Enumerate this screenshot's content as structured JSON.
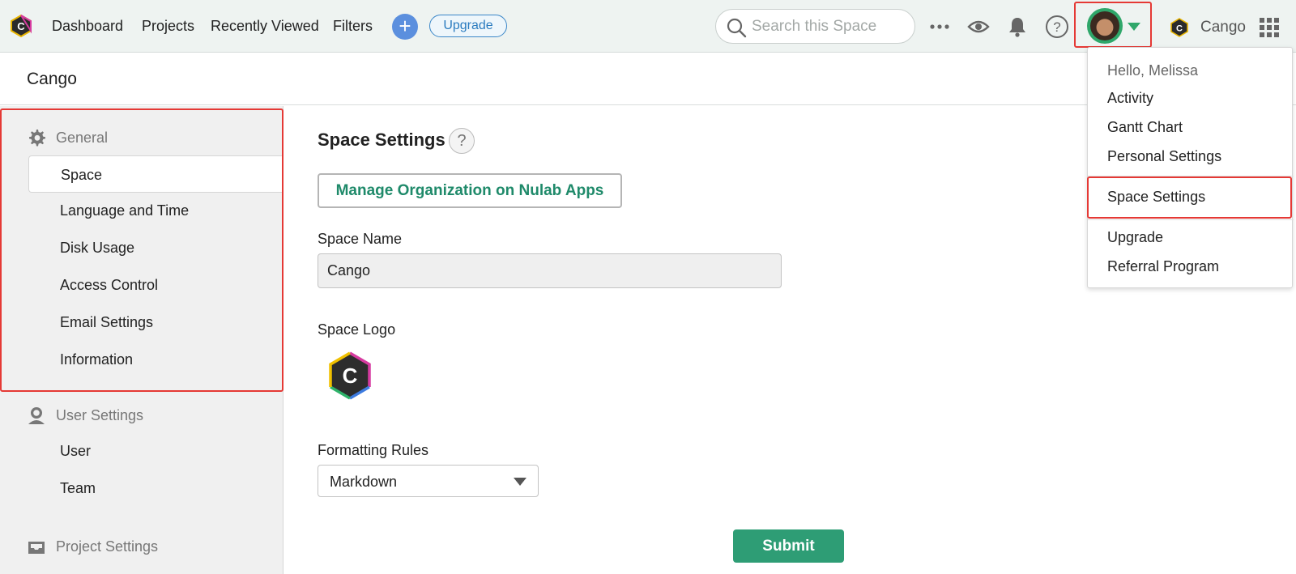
{
  "topbar": {
    "logo_icon": "cango-hexagon-logo",
    "nav": [
      "Dashboard",
      "Projects",
      "Recently Viewed",
      "Filters"
    ],
    "add_label": "+",
    "upgrade_label": "Upgrade",
    "search": {
      "placeholder": "Search this Space",
      "value": ""
    },
    "icons": [
      "more-icon",
      "watch-eye-icon",
      "bell-icon",
      "help-icon",
      "apps-grid-icon"
    ],
    "space_name": "Cango",
    "accent_color": "#2fa76a"
  },
  "header": {
    "title": "Cango"
  },
  "sidebar": {
    "sections": [
      {
        "label": "General",
        "icon": "gear-icon",
        "items": [
          "Space",
          "Language and Time",
          "Disk Usage",
          "Access Control",
          "Email Settings",
          "Information"
        ],
        "active": "Space"
      },
      {
        "label": "User Settings",
        "icon": "user-icon",
        "items": [
          "User",
          "Team"
        ]
      },
      {
        "label": "Project Settings",
        "icon": "inbox-icon",
        "items": []
      }
    ]
  },
  "main": {
    "title": "Space Settings",
    "help_label": "?",
    "manage_label": "Manage Organization on Nulab Apps",
    "space_name_label": "Space Name",
    "space_name_value": "Cango",
    "space_logo_label": "Space Logo",
    "formatting_label": "Formatting Rules",
    "formatting_value": "Markdown",
    "submit_label": "Submit",
    "submit_color": "#2e9d75"
  },
  "user_menu": {
    "greeting": "Hello, Melissa",
    "group1": [
      "Activity",
      "Gantt Chart",
      "Personal Settings"
    ],
    "group2": [
      "Space Settings"
    ],
    "group3": [
      "Upgrade",
      "Referral Program"
    ]
  }
}
